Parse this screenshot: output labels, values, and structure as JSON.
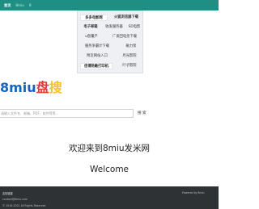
{
  "topbar": {
    "home": "首页",
    "site": "8miu",
    "extra": "8"
  },
  "dropdown": {
    "items": [
      "多多电影网",
      "火狐浏览器下载",
      "电子邮箱",
      "收发服务器",
      "SD电影",
      "u盘量产",
      "广发回电金下载",
      "服务争霸计下载",
      "磁力架",
      "附近网站入口",
      "月光影院",
      "佳博热敏打印机",
      "叶子影院"
    ]
  },
  "logo": {
    "part1": "8miu",
    "part2": "盘",
    "part3": "搜"
  },
  "search": {
    "placeholder": "请输入文件名、邮箱、PDF、软件等等...",
    "button": "搜 索"
  },
  "welcome": {
    "cn": "欢迎来到8miu发米网",
    "en": "Welcome"
  },
  "footer": {
    "title": "友情链接",
    "email": "contact@8miu.com",
    "copyright": "© 2016-2021 All Rights Reserved",
    "right": "Powered by 8miu"
  }
}
